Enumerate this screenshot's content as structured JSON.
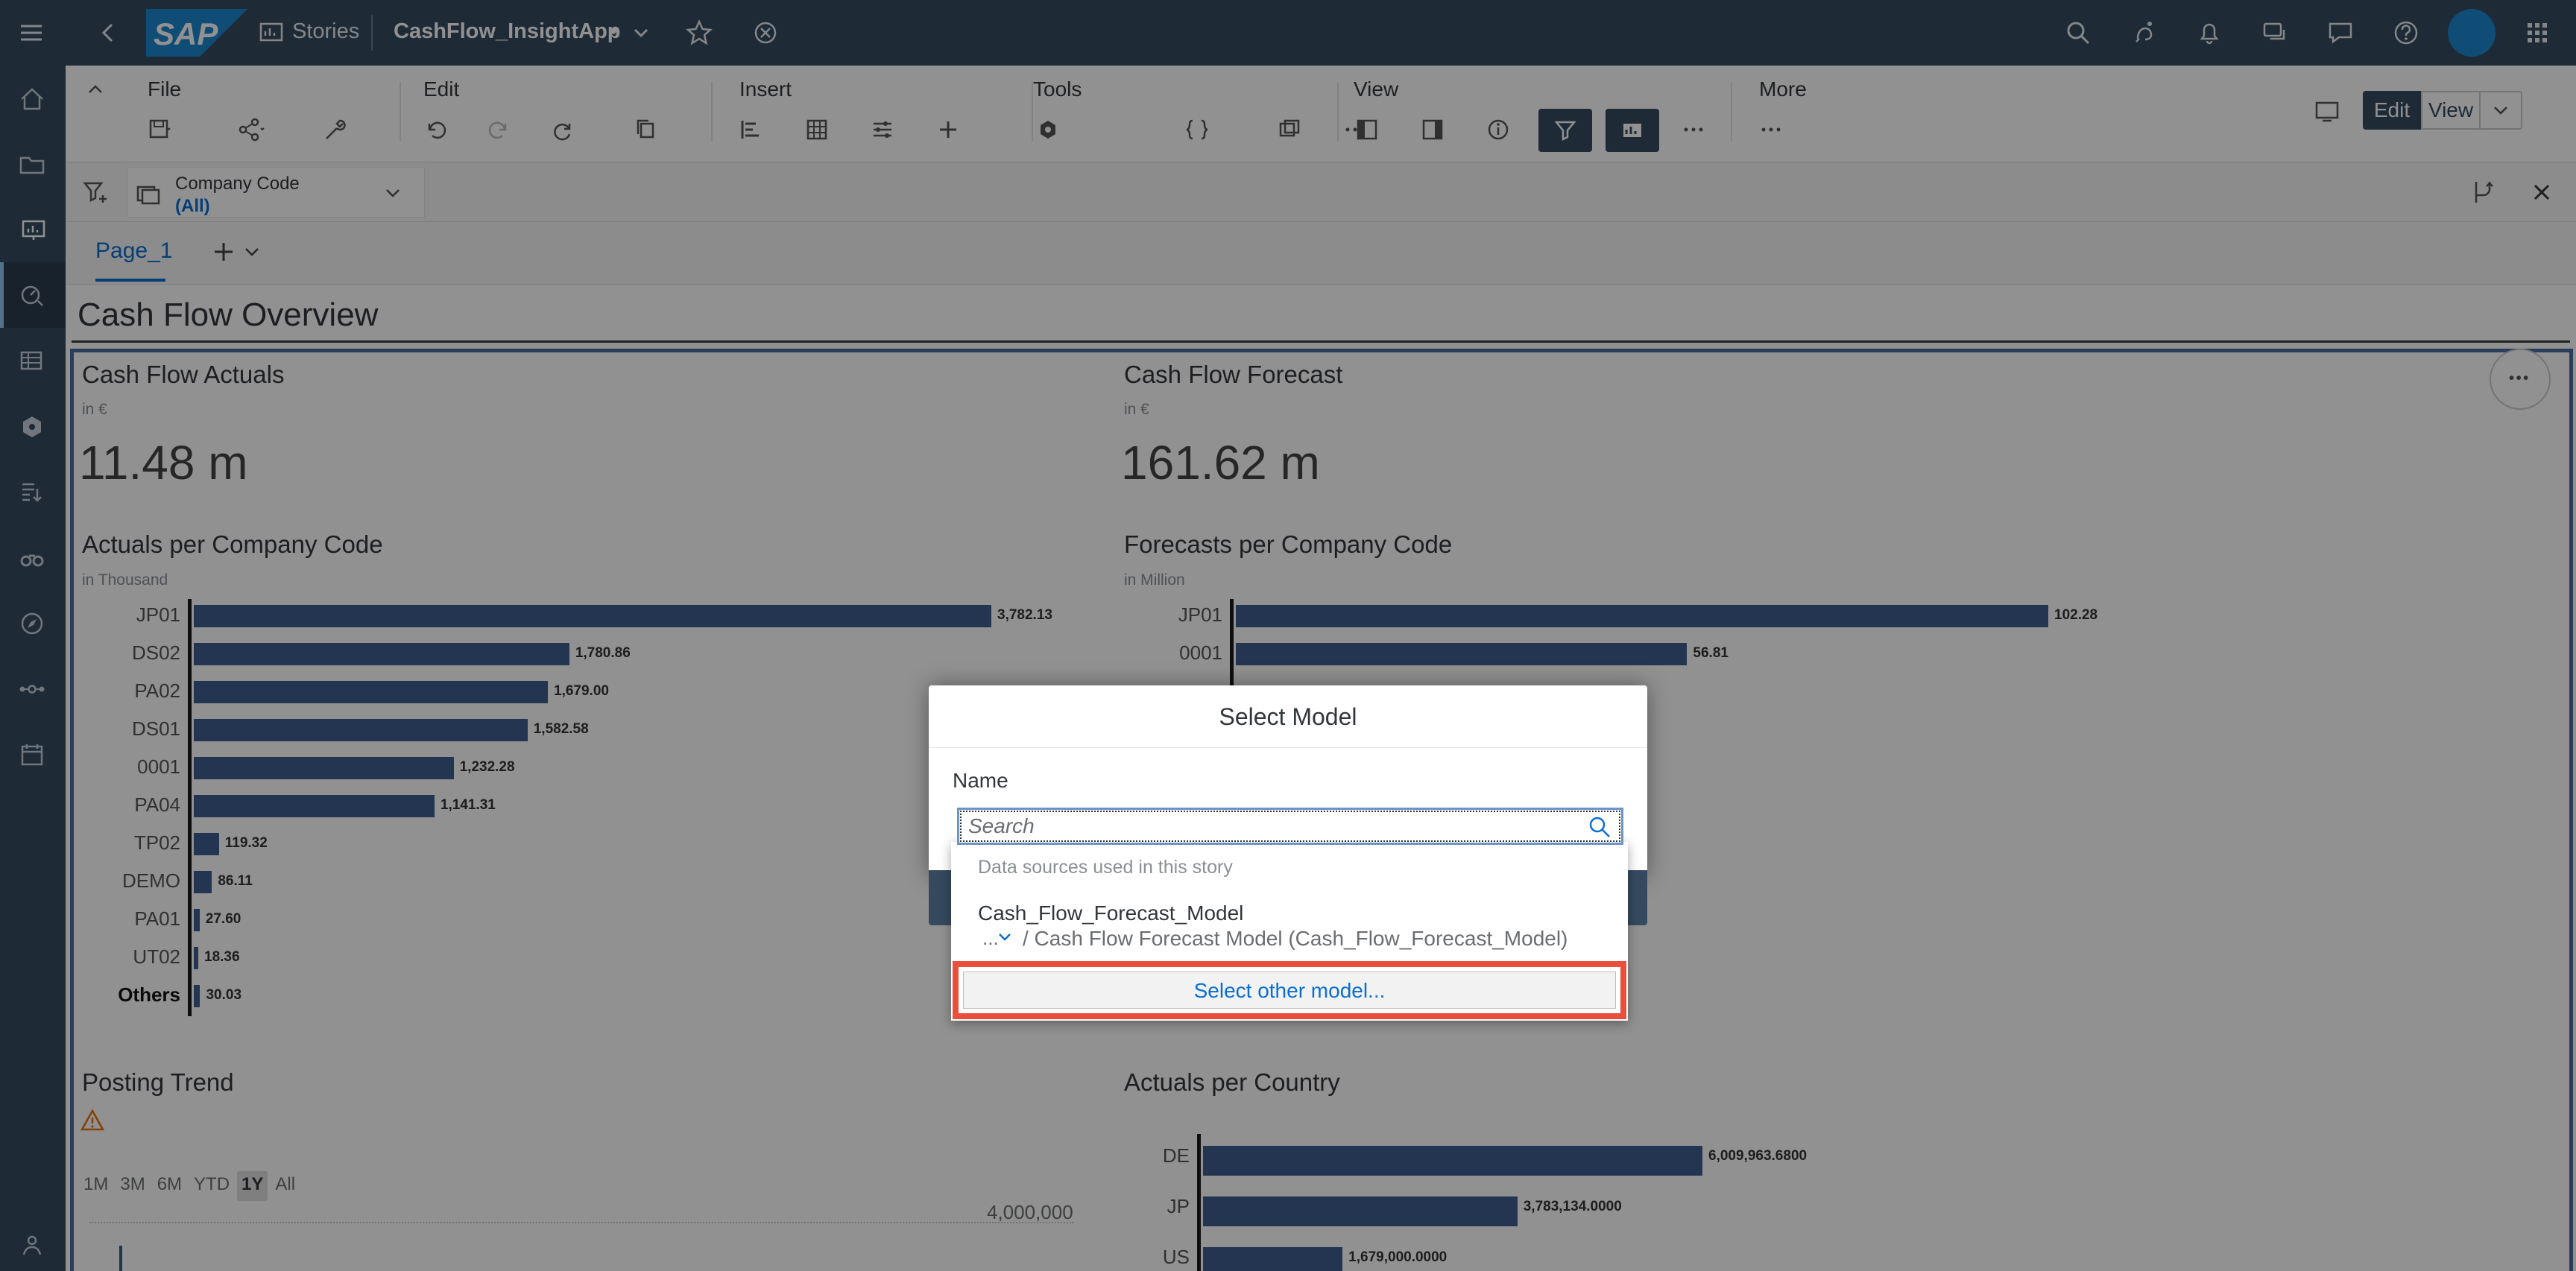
{
  "shell": {
    "logo_text": "SAP",
    "stories_label": "Stories",
    "story_name": "CashFlow_InsightApp",
    "unsaved_marker": "•"
  },
  "toolbar": {
    "file": "File",
    "edit": "Edit",
    "insert": "Insert",
    "tools": "Tools",
    "view": "View",
    "more": "More",
    "mode_edit": "Edit",
    "mode_view": "View"
  },
  "filter": {
    "label": "Company Code",
    "value": "(All)"
  },
  "page_tab": "Page_1",
  "page_title": "Cash Flow Overview",
  "kpi_actuals": {
    "title": "Cash Flow Actuals",
    "unit": "in €",
    "value": "11.48 m"
  },
  "kpi_forecast": {
    "title": "Cash Flow Forecast",
    "unit": "in €",
    "value": "161.62 m"
  },
  "chart_data": [
    {
      "type": "bar",
      "title": "Actuals per Company Code",
      "subtitle": "in Thousand",
      "categories": [
        "JP01",
        "DS02",
        "PA02",
        "DS01",
        "0001",
        "PA04",
        "TP02",
        "DEMO",
        "PA01",
        "UT02",
        "Others"
      ],
      "values": [
        3782.13,
        1780.86,
        1679.0,
        1582.58,
        1232.28,
        1141.31,
        119.32,
        86.11,
        27.6,
        18.36,
        30.03
      ],
      "labels": [
        "3,782.13",
        "1,780.86",
        "1,679.00",
        "1,582.58",
        "1,232.28",
        "1,141.31",
        "119.32",
        "86.11",
        "27.60",
        "18.36",
        "30.03"
      ]
    },
    {
      "type": "bar",
      "title": "Forecasts per Company Code",
      "subtitle": "in Million",
      "categories": [
        "JP01",
        "0001"
      ],
      "values": [
        102.28,
        56.81
      ],
      "labels": [
        "102.28",
        "56.81"
      ]
    },
    {
      "type": "bar",
      "title": "Actuals per Country",
      "categories": [
        "DE",
        "JP",
        "US"
      ],
      "values": [
        6009963.68,
        3783134.0,
        1679000.0
      ],
      "labels": [
        "6,009,963.6800",
        "3,783,134.0000",
        "1,679,000.0000"
      ]
    }
  ],
  "posting_trend": {
    "title": "Posting Trend",
    "ranges": [
      "1M",
      "3M",
      "6M",
      "YTD",
      "1Y",
      "All"
    ],
    "selected_range": "1Y",
    "axis_label": "4,000,000"
  },
  "dialog": {
    "title": "Select Model",
    "name_label": "Name",
    "search_placeholder": "Search",
    "section_header": "Data sources used in this story",
    "model_name": "Cash_Flow_Forecast_Model",
    "model_path_prefix": "...",
    "model_path": "/ Cash Flow Forecast Model (Cash_Flow_Forecast_Model)",
    "select_other": "Select other model..."
  }
}
